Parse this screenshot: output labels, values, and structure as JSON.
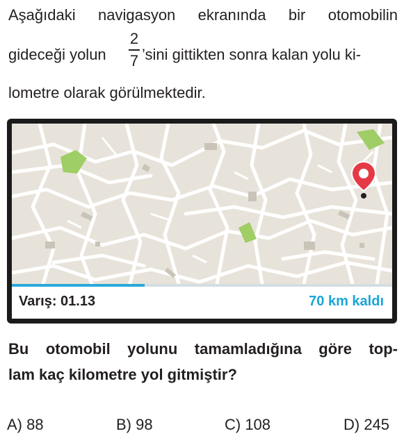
{
  "stem": {
    "line1": "Aşağıdaki navigasyon ekranında bir otomobilin",
    "line2_before": "gideceği yolun",
    "fraction_numerator": "2",
    "fraction_denominator": "7",
    "line2_after": "’sini gittikten sonra kalan yolu ki-",
    "line3": "lometre olarak görülmektedir."
  },
  "navigation": {
    "arrival_label": "Varış: 01.13",
    "remaining_label": "70 km kaldı",
    "progress_fraction": 0.35,
    "colors": {
      "map_bg": "#e8e3da",
      "road": "#ffffff",
      "park": "#9fcd66",
      "pin": "#e63946",
      "progress": "#2aa8d8",
      "remaining_text": "#1aa5d6"
    },
    "pin_icon": "location-pin-icon"
  },
  "question": {
    "line1": "Bu otomobil yolunu tamamladığına göre top-",
    "line2": "lam kaç kilometre yol gitmiştir?"
  },
  "options": [
    {
      "label": "A) 88"
    },
    {
      "label": "B) 98"
    },
    {
      "label": "C) 108"
    },
    {
      "label": "D) 245"
    }
  ]
}
